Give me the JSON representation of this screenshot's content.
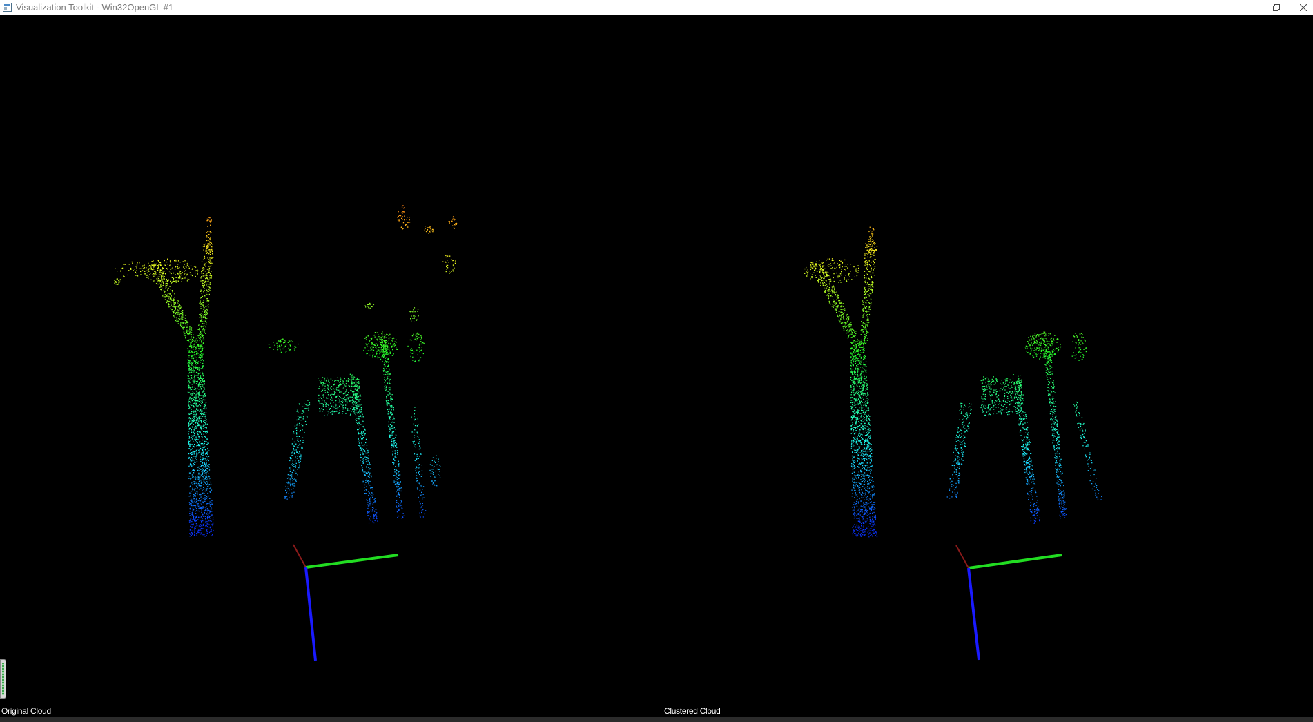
{
  "window": {
    "title": "Visualization Toolkit - Win32OpenGL #1",
    "icons": {
      "app": "vtk-app-icon",
      "minimize": "minimize-icon",
      "maximize": "restore-icon",
      "close": "close-icon"
    }
  },
  "viewports": [
    {
      "label": "Original Cloud"
    },
    {
      "label": "Clustered Cloud"
    }
  ],
  "colors": {
    "background": "#000000",
    "axis_x": "#8b1a1a",
    "axis_y": "#22dd22",
    "axis_z": "#1a1aff",
    "point_high": "#ff3010",
    "point_low": "#2040ff"
  }
}
